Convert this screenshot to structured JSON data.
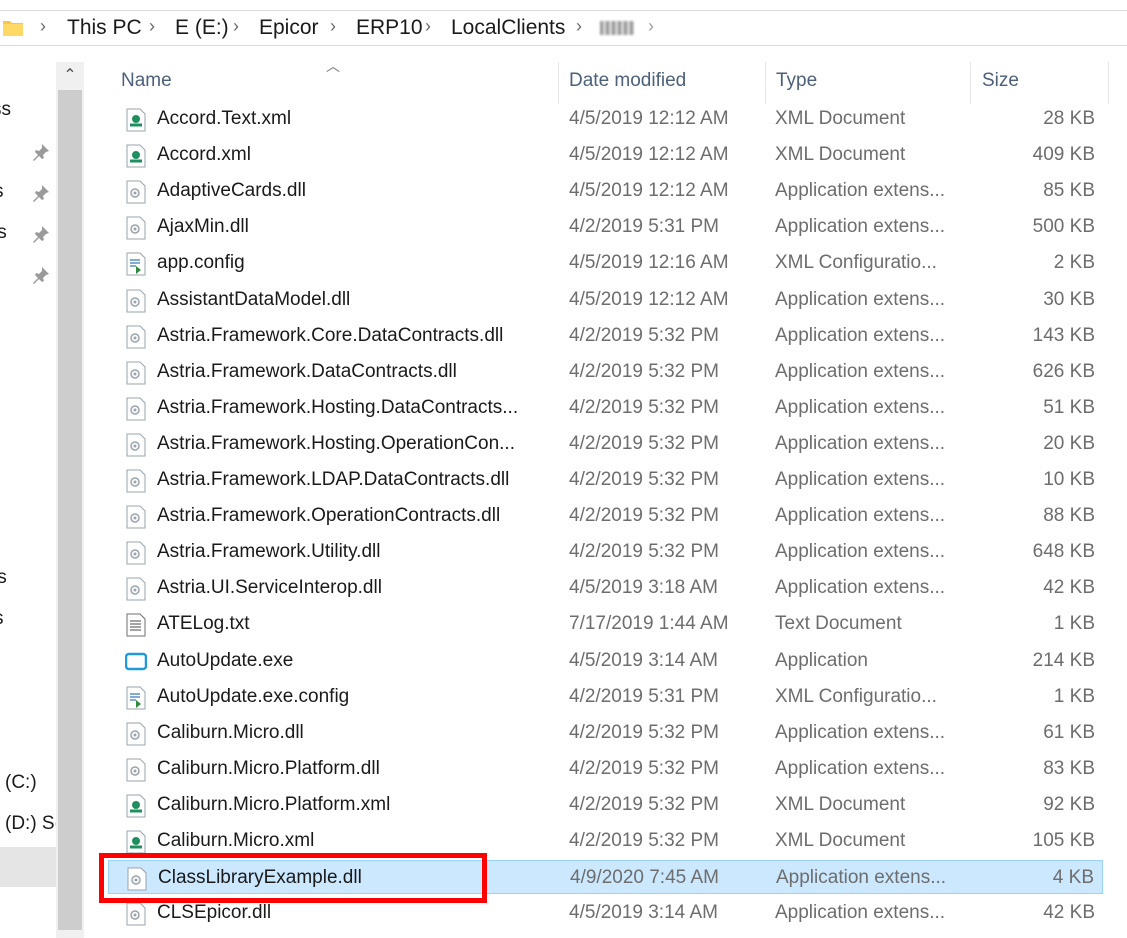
{
  "breadcrumb": {
    "items": [
      "This PC",
      "E (E:)",
      "Epicor",
      "ERP10",
      "LocalClients"
    ],
    "separator": "›"
  },
  "nav": {
    "labels": [
      "ss",
      "s",
      "ts",
      "ts",
      "s",
      "(C:)",
      "(D:) S("
    ]
  },
  "columns": {
    "name": "Name",
    "date": "Date modified",
    "type": "Type",
    "size": "Size"
  },
  "files": [
    {
      "name": "Accord.Text.xml",
      "date": "4/5/2019 12:12 AM",
      "type": "XML Document",
      "size": "28 KB",
      "icon": "xml-document-icon"
    },
    {
      "name": "Accord.xml",
      "date": "4/5/2019 12:12 AM",
      "type": "XML Document",
      "size": "409 KB",
      "icon": "xml-document-icon"
    },
    {
      "name": "AdaptiveCards.dll",
      "date": "4/5/2019 12:12 AM",
      "type": "Application extens...",
      "size": "85 KB",
      "icon": "dll-icon"
    },
    {
      "name": "AjaxMin.dll",
      "date": "4/2/2019 5:31 PM",
      "type": "Application extens...",
      "size": "500 KB",
      "icon": "dll-icon"
    },
    {
      "name": "app.config",
      "date": "4/5/2019 12:16 AM",
      "type": "XML Configuratio...",
      "size": "2 KB",
      "icon": "config-icon"
    },
    {
      "name": "AssistantDataModel.dll",
      "date": "4/5/2019 12:12 AM",
      "type": "Application extens...",
      "size": "30 KB",
      "icon": "dll-icon"
    },
    {
      "name": "Astria.Framework.Core.DataContracts.dll",
      "date": "4/2/2019 5:32 PM",
      "type": "Application extens...",
      "size": "143 KB",
      "icon": "dll-icon"
    },
    {
      "name": "Astria.Framework.DataContracts.dll",
      "date": "4/2/2019 5:32 PM",
      "type": "Application extens...",
      "size": "626 KB",
      "icon": "dll-icon"
    },
    {
      "name": "Astria.Framework.Hosting.DataContracts...",
      "date": "4/2/2019 5:32 PM",
      "type": "Application extens...",
      "size": "51 KB",
      "icon": "dll-icon"
    },
    {
      "name": "Astria.Framework.Hosting.OperationCon...",
      "date": "4/2/2019 5:32 PM",
      "type": "Application extens...",
      "size": "20 KB",
      "icon": "dll-icon"
    },
    {
      "name": "Astria.Framework.LDAP.DataContracts.dll",
      "date": "4/2/2019 5:32 PM",
      "type": "Application extens...",
      "size": "10 KB",
      "icon": "dll-icon"
    },
    {
      "name": "Astria.Framework.OperationContracts.dll",
      "date": "4/2/2019 5:32 PM",
      "type": "Application extens...",
      "size": "88 KB",
      "icon": "dll-icon"
    },
    {
      "name": "Astria.Framework.Utility.dll",
      "date": "4/2/2019 5:32 PM",
      "type": "Application extens...",
      "size": "648 KB",
      "icon": "dll-icon"
    },
    {
      "name": "Astria.UI.ServiceInterop.dll",
      "date": "4/5/2019 3:18 AM",
      "type": "Application extens...",
      "size": "42 KB",
      "icon": "dll-icon"
    },
    {
      "name": "ATELog.txt",
      "date": "7/17/2019 1:44 AM",
      "type": "Text Document",
      "size": "1 KB",
      "icon": "text-document-icon"
    },
    {
      "name": "AutoUpdate.exe",
      "date": "4/5/2019 3:14 AM",
      "type": "Application",
      "size": "214 KB",
      "icon": "application-icon"
    },
    {
      "name": "AutoUpdate.exe.config",
      "date": "4/2/2019 5:31 PM",
      "type": "XML Configuratio...",
      "size": "1 KB",
      "icon": "config-icon"
    },
    {
      "name": "Caliburn.Micro.dll",
      "date": "4/2/2019 5:32 PM",
      "type": "Application extens...",
      "size": "61 KB",
      "icon": "dll-icon"
    },
    {
      "name": "Caliburn.Micro.Platform.dll",
      "date": "4/2/2019 5:32 PM",
      "type": "Application extens...",
      "size": "83 KB",
      "icon": "dll-icon"
    },
    {
      "name": "Caliburn.Micro.Platform.xml",
      "date": "4/2/2019 5:32 PM",
      "type": "XML Document",
      "size": "92 KB",
      "icon": "xml-document-icon"
    },
    {
      "name": "Caliburn.Micro.xml",
      "date": "4/2/2019 5:32 PM",
      "type": "XML Document",
      "size": "105 KB",
      "icon": "xml-document-icon"
    },
    {
      "name": "ClassLibraryExample.dll",
      "date": "4/9/2020 7:45 AM",
      "type": "Application extens...",
      "size": "4 KB",
      "icon": "dll-icon",
      "selected": true
    },
    {
      "name": "CLSEpicor.dll",
      "date": "4/5/2019 3:14 AM",
      "type": "Application extens...",
      "size": "42 KB",
      "icon": "dll-icon"
    }
  ],
  "colors": {
    "selection": "#cce8ff",
    "selection_border": "#99d1ff",
    "highlight": "#ff0000",
    "header_text": "#4c607a"
  }
}
